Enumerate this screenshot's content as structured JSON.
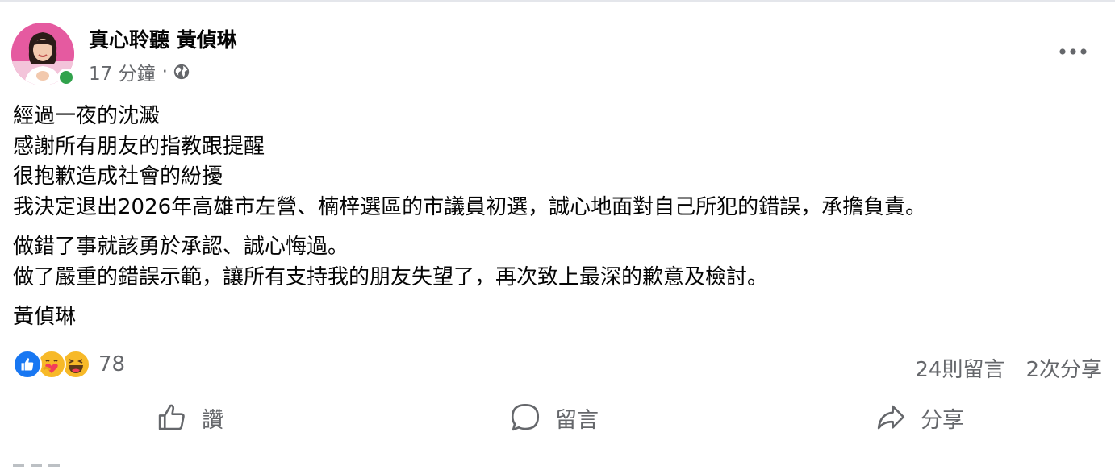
{
  "post": {
    "author": "真心聆聽 黃偵琳",
    "timestamp": "17 分鐘",
    "separator": "·",
    "audience_icon": "globe-icon",
    "more_icon": "more-options-icon",
    "paragraphs": [
      [
        "經過一夜的沈澱",
        "感謝所有朋友的指教跟提醒",
        "很抱歉造成社會的紛擾",
        "我決定退出2026年高雄市左營、楠梓選區的市議員初選，誠心地面對自己所犯的錯誤，承擔負責。"
      ],
      [
        "做錯了事就該勇於承認、誠心悔過。",
        "做了嚴重的錯誤示範，讓所有支持我的朋友失望了，再次致上最深的歉意及檢討。"
      ],
      [
        "黃偵琳"
      ]
    ]
  },
  "reactions": {
    "types": [
      "like",
      "care",
      "haha"
    ],
    "count": "78",
    "comments": "24則留言",
    "shares": "2次分享"
  },
  "actions": {
    "like_label": "讚",
    "comment_label": "留言",
    "share_label": "分享"
  },
  "colors": {
    "like_blue": "#1877f2",
    "emoji_yellow": "#f7b928",
    "secondary_text": "#65676b",
    "online_green": "#31a24c",
    "avatar_pink": "#e55aa0"
  }
}
